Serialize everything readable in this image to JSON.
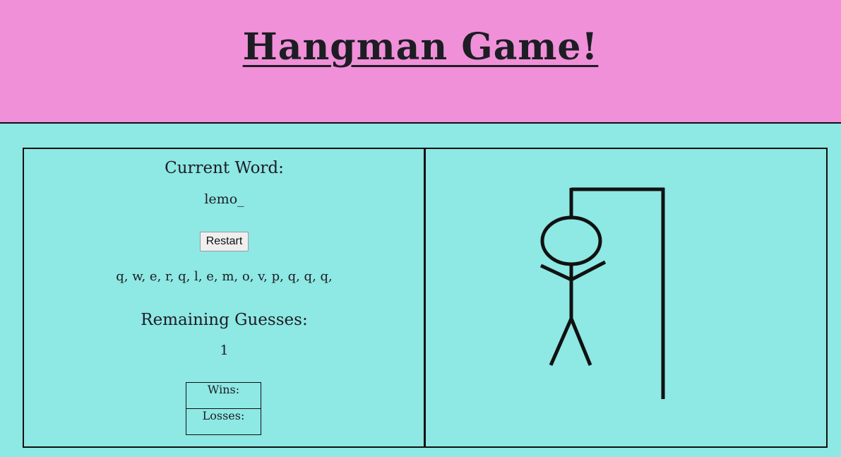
{
  "header": {
    "title": "Hangman Game!"
  },
  "game": {
    "current_word_label": "Current Word:",
    "current_word": "lemo_",
    "restart_label": "Restart",
    "guessed_letters": "q, w, e, r, q, l, e, m, o, v, p, q, q, q,",
    "remaining_label": "Remaining Guesses:",
    "remaining_value": "1",
    "wins_label": "Wins:",
    "losses_label": "Losses:"
  },
  "colors": {
    "header_bg": "#f090d9",
    "body_bg": "#8ee8e4",
    "ink": "#111111"
  }
}
